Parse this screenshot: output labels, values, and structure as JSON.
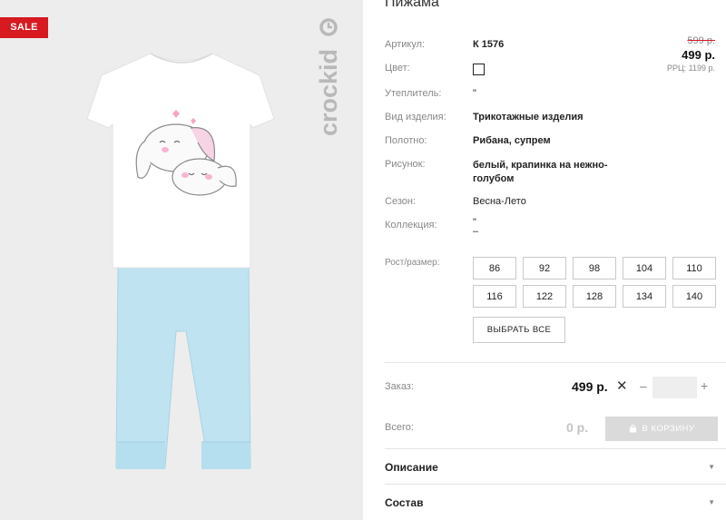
{
  "badge": {
    "sale": "SALE"
  },
  "brand": {
    "name": "crockid"
  },
  "product": {
    "title": "Пижама",
    "specs": [
      {
        "label": "Артикул:",
        "value": "К 1576"
      },
      {
        "label": "Цвет:",
        "value": ""
      },
      {
        "label": "Утеплитель:",
        "value": "\""
      },
      {
        "label": "Вид изделия:",
        "value": "Трикотажные изделия"
      },
      {
        "label": "Полотно:",
        "value": "Рибана, супрем"
      },
      {
        "label": "Рисунок:",
        "value": "белый, крапинка на нежно-голубом"
      },
      {
        "label": "Сезон:",
        "value": "Весна-Лето"
      },
      {
        "label": "Коллекция:",
        "value": "\""
      }
    ],
    "collection_dash": "–"
  },
  "price": {
    "old": "599 р.",
    "new": "499 р.",
    "rrp": "РРЦ: 1199 р."
  },
  "sizes": {
    "label": "Рост/размер:",
    "options": [
      "86",
      "92",
      "98",
      "104",
      "110",
      "116",
      "122",
      "128",
      "134",
      "140"
    ],
    "select_all": "ВЫБРАТЬ ВСЕ"
  },
  "order": {
    "label": "Заказ:",
    "price": "499 р.",
    "times": "✕",
    "minus": "–",
    "plus": "+",
    "quantity": ""
  },
  "total": {
    "label": "Всего:",
    "value": "0 р.",
    "cart_button": "В КОРЗИНУ"
  },
  "accordions": [
    {
      "title": "Описание"
    },
    {
      "title": "Состав"
    }
  ],
  "icons": {
    "accordion_arrow": "▼",
    "cart": "cart-icon"
  },
  "colors": {
    "sale": "#d71920",
    "swatch": "#ffffff",
    "pants": "#bfe3f1",
    "cart_disabled": "#dadada"
  }
}
